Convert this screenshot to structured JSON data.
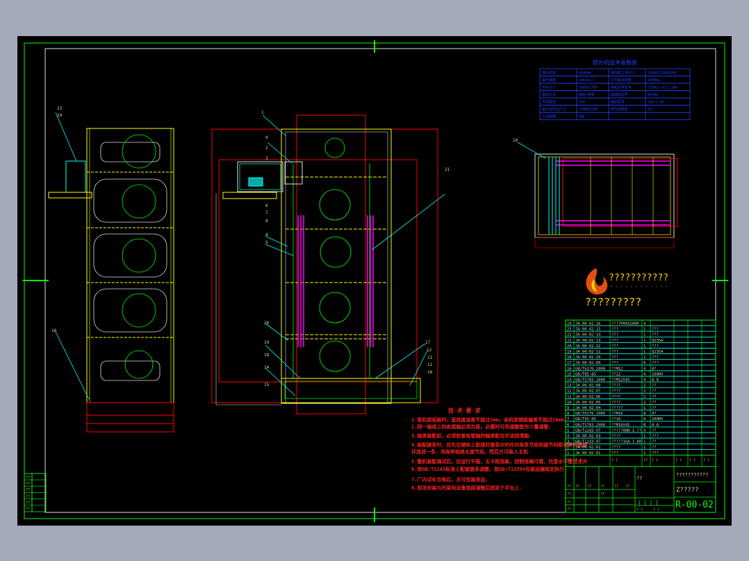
{
  "colors": {
    "background": "#a3abbb",
    "canvas": "#000000",
    "frame": "#00ff00",
    "red": "#ff0000",
    "yellow": "#ffff00",
    "cyan": "#00ffff",
    "magenta": "#ff00ff",
    "blue": "#0000ff",
    "white": "#ffffff"
  },
  "spec_table": {
    "title": "提升机技术参数表",
    "rows": [
      [
        "提升高度",
        "4500mm",
        "提升机工作尺寸",
        "1500X1500X4500"
      ],
      [
        "提升速度",
        "10m/min",
        "工作最大荷重",
        "1000kg"
      ],
      [
        "外形尺寸",
        "2885X1700",
        "电机功率型号",
        "Y100L1-4/2.2kW"
      ],
      [
        "驱动方式",
        "链条/电机",
        "减速机型号",
        "WPA80"
      ],
      [
        "传动链条",
        "16A",
        "链条型号",
        "16A-1-80"
      ],
      [
        "最大单件总尺寸",
        "1500X1500",
        "电气控制柜",
        "PLC"
      ],
      [
        "工作层数",
        "4层",
        "",
        " "
      ]
    ]
  },
  "balloons": {
    "left_view": [
      "23",
      "24",
      "16"
    ],
    "front_view": [
      "1",
      "9",
      "2",
      "3",
      "6",
      "7",
      "8",
      "4",
      "5",
      "20",
      "19",
      "18",
      "14",
      "15",
      "21",
      "17",
      "12",
      "13",
      "11",
      "10"
    ],
    "top_view": [
      "10"
    ]
  },
  "logo": {
    "name_line": "???????????",
    "dots": ". . . . . . . . . . . .",
    "subtitle": "?????????"
  },
  "tech_requirements": {
    "title": "技 术 要 求",
    "items": [
      "1.管机架组装时，直线度误差不超过5mm，各机架侧面偏差不超过10mm.",
      "2.同一轴线上的各辊轴必须共面，必要时可用调整垫作少量调整.",
      "3.轴承装配前，必须检查各辊轴的轴承配合并涂润滑脂.",
      "4.装配链条时，应先在链轮上联接好链条中的任何单条节段和链节间距相等的链接",
      "  并连成一条，用各种规格长度节段，然后方可装入主机.",
      "5.整机装配调试后，应运行平稳，无卡阻现象，控制准确可靠，托盘水平度在允许",
      "6.按GB/T1243标准上配套链条调整，按GB/T13384包装运输规定执行.",
      "7.厂内试车合格后，方可包装发运.",
      "8.现场安装与托架间设备连接调整后固定于平台上."
    ]
  },
  "parts_list": [
    [
      "24",
      "JA-00-02-16",
      "????PHXX2000",
      "4",
      "",
      ""
    ],
    [
      "23",
      "JA-00-02-15",
      "???",
      "1",
      "???",
      ""
    ],
    [
      "22",
      "JA-00-02-14",
      "???",
      "1",
      "???",
      ""
    ],
    [
      "21",
      "JA-00-02-13",
      "???",
      "1",
      "Q235A",
      ""
    ],
    [
      "20",
      "JA-00-02-12",
      "???",
      "1",
      "???",
      ""
    ],
    [
      "19",
      "JA-00-02-11",
      "???",
      "1",
      "Q235A",
      ""
    ],
    [
      "18",
      "JA-00-02-10",
      "???",
      "2",
      "???",
      ""
    ],
    [
      "17",
      "JA-00-02-09",
      "???",
      "6",
      "???",
      ""
    ],
    [
      "16",
      "GB/T6170-2000",
      "??M12",
      "4",
      "8?",
      ""
    ],
    [
      "15",
      "GB/T95-85",
      "??12",
      "4",
      "100HV",
      ""
    ],
    [
      "14",
      "GB/T5783-2000",
      "??M12X45",
      "4",
      "8.8",
      ""
    ],
    [
      "13",
      "JA-00-02-08",
      "????",
      "2",
      "??",
      ""
    ],
    [
      "12",
      "JA-00-02-07",
      "????",
      "2",
      "??",
      ""
    ],
    [
      "11",
      "JA-00-02-06",
      "????",
      "2",
      "??",
      ""
    ],
    [
      "10",
      "JA-00-02-05",
      "????",
      "2",
      "??",
      ""
    ],
    [
      "9",
      "JA-00-02-04",
      "?????",
      "1",
      "??",
      ""
    ],
    [
      "8",
      "GB/T6170-2000",
      "??M16",
      "8",
      "8?",
      ""
    ],
    [
      "7",
      "GB/T95-85",
      "??16",
      "8",
      "100HV",
      ""
    ],
    [
      "6",
      "GB/T5783-2000",
      "??M16X45",
      "8",
      "8.8",
      ""
    ],
    [
      "5",
      "GB/T1243-97",
      "?????08B-1-??",
      "4",
      "??",
      ""
    ],
    [
      "4",
      "JA-00-02-03",
      "????",
      "1",
      "???",
      ""
    ],
    [
      "3",
      "GB/T1243-97",
      "?????16A-1-80",
      "1",
      "??",
      ""
    ],
    [
      "2",
      "JA-00-02-02",
      "????",
      "1",
      "??",
      ""
    ],
    [
      "1",
      "JA-00-02-01",
      "???",
      "1",
      "???",
      ""
    ]
  ],
  "parts_header": [
    "??",
    "?  ?",
    "?  ?",
    "??",
    "?  ?",
    "? ?",
    "? ?",
    "? ?",
    "? ?"
  ],
  "title_block": {
    "company": "???????????",
    "drawing_name": "Z?????",
    "drawing_number": "R-00-02",
    "material": "??",
    "stage_marks": "| | | |",
    "cells": [
      "??",
      "??",
      "??",
      "??",
      "??",
      "??",
      "??",
      "??",
      "??",
      "??",
      "?  ?",
      "?  ?"
    ]
  },
  "revision_block": [
    "??",
    "??",
    "??",
    "??",
    "??",
    "??"
  ]
}
